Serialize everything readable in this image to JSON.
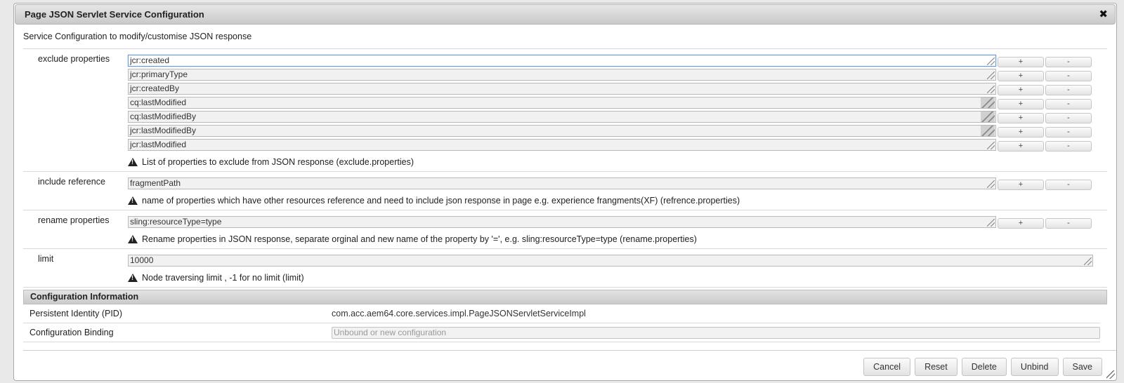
{
  "dialog": {
    "title": "Page JSON Servlet Service Configuration",
    "close_glyph": "✖",
    "description": "Service Configuration to modify/customise JSON response"
  },
  "fields": {
    "exclude": {
      "label": "exclude properties",
      "values": [
        "jcr:created",
        "jcr:primaryType",
        "jcr:createdBy",
        "cq:lastModified",
        "cq:lastModifiedBy",
        "jcr:lastModifiedBy",
        "jcr:lastModified"
      ],
      "hint": "List of properties to exclude from JSON response (exclude.properties)"
    },
    "include": {
      "label": "include reference",
      "values": [
        "fragmentPath"
      ],
      "hint": "name of properties which have other resources reference and need to include json response in page e.g. experience frangments(XF) (refrence.properties)"
    },
    "rename": {
      "label": "rename properties",
      "values": [
        "sling:resourceType=type"
      ],
      "hint": "Rename properties in JSON response, separate orginal and new name of the property by '=', e.g. sling:resourceType=type (rename.properties)"
    },
    "limit": {
      "label": "limit",
      "value": "10000",
      "hint": "Node traversing limit , -1 for no limit (limit)"
    },
    "add_label": "+",
    "remove_label": "-"
  },
  "config_info": {
    "header": "Configuration Information",
    "pid_label": "Persistent Identity (PID)",
    "pid_value": "com.acc.aem64.core.services.impl.PageJSONServletServiceImpl",
    "binding_label": "Configuration Binding",
    "binding_placeholder": "Unbound or new configuration"
  },
  "footer": {
    "cancel": "Cancel",
    "reset": "Reset",
    "delete": "Delete",
    "unbind": "Unbind",
    "save": "Save"
  }
}
